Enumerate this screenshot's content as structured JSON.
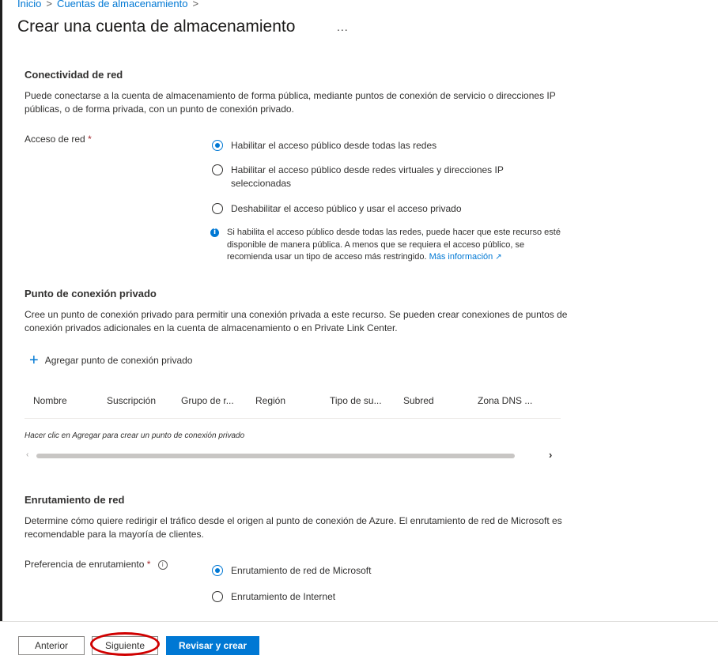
{
  "breadcrumb": {
    "home": "Inicio",
    "parent": "Cuentas de almacenamiento",
    "separator": ">"
  },
  "page": {
    "title": "Crear una cuenta de almacenamiento",
    "more_label": "..."
  },
  "network": {
    "title": "Conectividad de red",
    "description": "Puede conectarse a la cuenta de almacenamiento de forma pública, mediante puntos de conexión de servicio o direcciones IP públicas, o de forma privada, con un punto de conexión privado.",
    "access_label": "Acceso de red",
    "required_mark": "*",
    "options": [
      {
        "label": "Habilitar el acceso público desde todas las redes",
        "checked": true
      },
      {
        "label": "Habilitar el acceso público desde redes virtuales y direcciones IP seleccionadas",
        "checked": false
      },
      {
        "label": "Deshabilitar el acceso público y usar el acceso privado",
        "checked": false
      }
    ],
    "info_text": "Si habilita el acceso público desde todas las redes, puede hacer que este recurso esté disponible de manera pública. A menos que se requiera el acceso público, se recomienda usar un tipo de acceso más restringido.",
    "info_link": "Más información"
  },
  "private_endpoint": {
    "title": "Punto de conexión privado",
    "description": "Cree un punto de conexión privado para permitir una conexión privada a este recurso. Se pueden crear conexiones de puntos de conexión privados adicionales en la cuenta de almacenamiento o en Private Link Center.",
    "add_label": "Agregar punto de conexión privado",
    "columns": [
      "Nombre",
      "Suscripción",
      "Grupo de r...",
      "Región",
      "Tipo de su...",
      "Subred",
      "Zona DNS ..."
    ],
    "empty_message": "Hacer clic en Agregar para crear un punto de conexión privado"
  },
  "routing": {
    "title": "Enrutamiento de red",
    "description": "Determine cómo quiere redirigir el tráfico desde el origen al punto de conexión de Azure. El enrutamiento de red de Microsoft es recomendable para la mayoría de clientes.",
    "preference_label": "Preferencia de enrutamiento",
    "required_mark": "*",
    "options": [
      {
        "label": "Enrutamiento de red de Microsoft",
        "checked": true
      },
      {
        "label": "Enrutamiento de Internet",
        "checked": false
      }
    ]
  },
  "footer": {
    "previous": "Anterior",
    "next": "Siguiente",
    "review": "Revisar y crear"
  },
  "colors": {
    "accent": "#0078d4",
    "highlight": "#d00000",
    "required": "#a4262c"
  }
}
